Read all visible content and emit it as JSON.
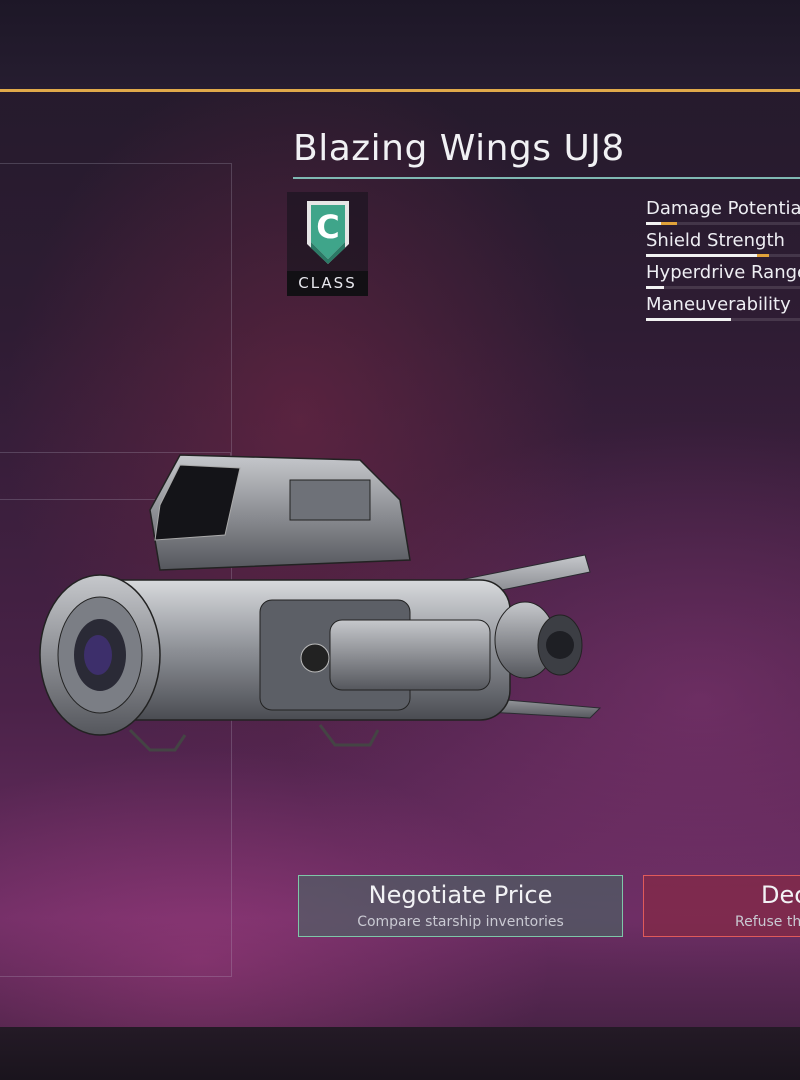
{
  "ship": {
    "name": "Blazing Wings UJ8",
    "class_letter": "C",
    "class_label": "CLASS"
  },
  "stats": [
    {
      "label": "Damage Potential",
      "value": 0.1,
      "bonus": 0.1
    },
    {
      "label": "Shield Strength",
      "value": 0.72,
      "bonus": 0.08
    },
    {
      "label": "Hyperdrive Range",
      "value": 0.12,
      "bonus": 0.0
    },
    {
      "label": "Maneuverability",
      "value": 0.55,
      "bonus": 0.0
    }
  ],
  "actions": {
    "negotiate": {
      "title": "Negotiate Price",
      "subtitle": "Compare starship inventories"
    },
    "decline": {
      "title": "Decline",
      "subtitle": "Refuse the offer"
    }
  },
  "colors": {
    "accent_gold": "#e0a94a",
    "accept_border": "#7ec7a8",
    "decline_border": "#e05a5a",
    "class_c_green": "#3fa58a"
  }
}
